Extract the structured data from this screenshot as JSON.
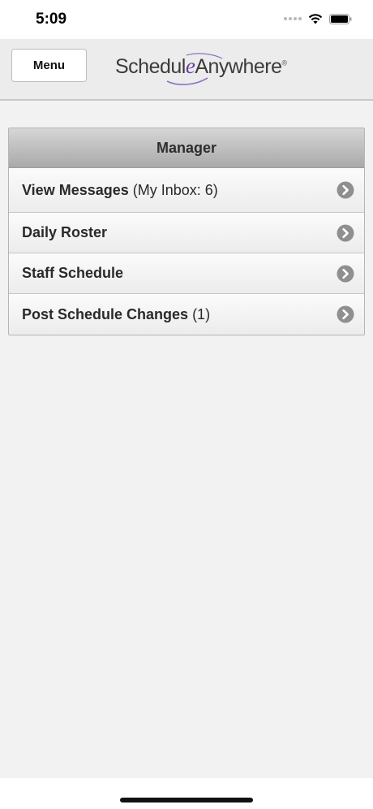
{
  "status_bar": {
    "time": "5:09",
    "icons": [
      "signal-dots-icon",
      "wifi-icon",
      "battery-icon"
    ]
  },
  "header": {
    "menu_label": "Menu",
    "logo": {
      "part1": "Schedul",
      "part2": "e",
      "part3": "Anywhere",
      "reg": "®"
    }
  },
  "manager": {
    "title": "Manager",
    "items": [
      {
        "label": "View Messages",
        "suffix": "(My Inbox: 6)"
      },
      {
        "label": "Daily Roster",
        "suffix": ""
      },
      {
        "label": "Staff Schedule",
        "suffix": ""
      },
      {
        "label": "Post Schedule Changes",
        "suffix": "(1)"
      }
    ]
  },
  "colors": {
    "page_bg": "#f2f2f2",
    "header_bg": "#ececec",
    "logo_accent": "#6a3fa0",
    "chevron": "#8f8f8f"
  }
}
